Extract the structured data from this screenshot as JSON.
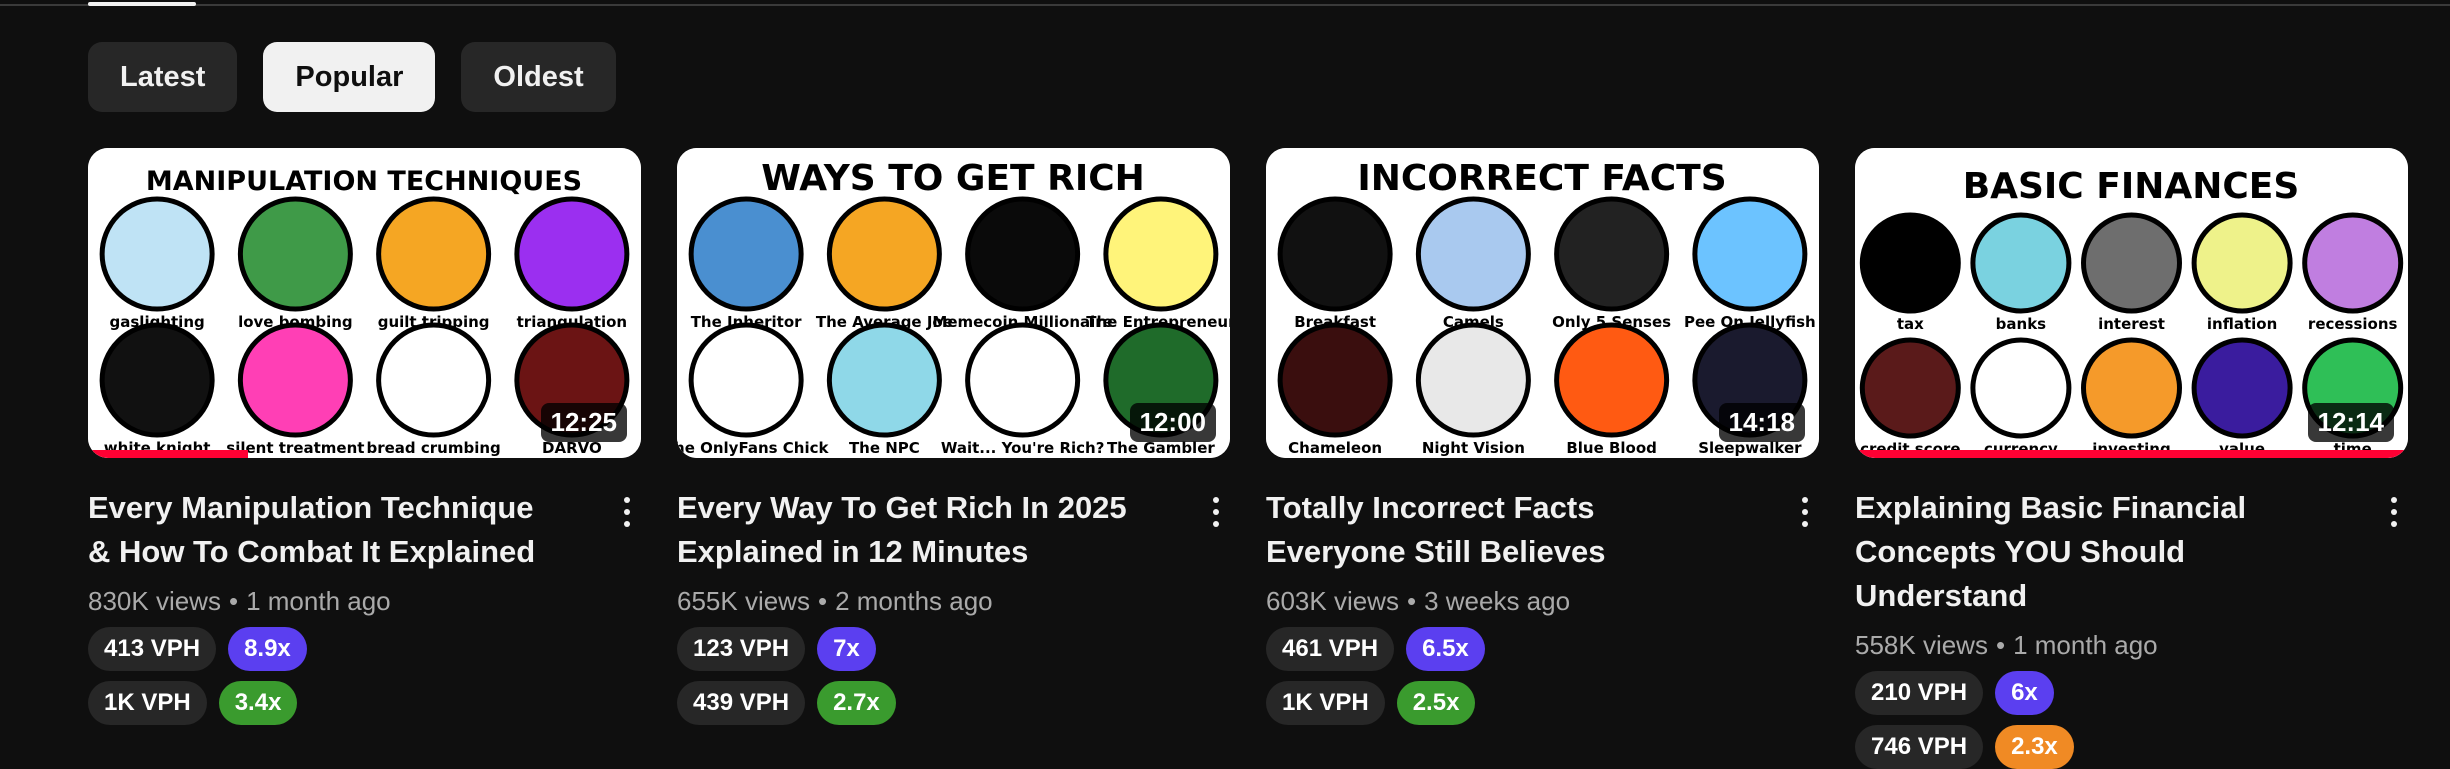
{
  "filters": [
    {
      "label": "Latest",
      "selected": false
    },
    {
      "label": "Popular",
      "selected": true
    },
    {
      "label": "Oldest",
      "selected": false
    }
  ],
  "colors": {
    "background": "#0f0f0f",
    "chip": "#272727",
    "chip_selected": "#f1f1f1",
    "progress": "#ff0033",
    "purple": "#5b3ff0",
    "green": "#3a9b2e",
    "orange": "#f08a24"
  },
  "videos": [
    {
      "thumb_title": "MANIPULATION TECHNIQUES",
      "thumb_labels": [
        "gaslighting",
        "love bombing",
        "guilt tripping",
        "triangulation",
        "white knight",
        "silent treatment",
        "bread crumbing",
        "DARVO"
      ],
      "duration": "12:25",
      "progress": 0.29,
      "title": "Every Manipulation Technique & How To Combat It Explained",
      "views": "830K views",
      "age": "1 month ago",
      "badges": [
        [
          {
            "text": "413 VPH",
            "color": "#272727"
          },
          {
            "text": "8.9x",
            "color": "#5b3ff0"
          }
        ],
        [
          {
            "text": "1K VPH",
            "color": "#272727"
          },
          {
            "text": "3.4x",
            "color": "#3a9b2e"
          }
        ]
      ]
    },
    {
      "thumb_title": "WAYS TO GET RICH",
      "thumb_labels": [
        "The Inheritor",
        "The Average Joe",
        "Memecoin Millionaire",
        "The Entrepreneur",
        "The OnlyFans Chick",
        "The NPC",
        "Wait... You're Rich?",
        "The Gambler"
      ],
      "duration": "12:00",
      "progress": 0,
      "title": "Every Way To Get Rich In 2025 Explained in 12 Minutes",
      "views": "655K views",
      "age": "2 months ago",
      "badges": [
        [
          {
            "text": "123 VPH",
            "color": "#272727"
          },
          {
            "text": "7x",
            "color": "#5b3ff0"
          }
        ],
        [
          {
            "text": "439 VPH",
            "color": "#272727"
          },
          {
            "text": "2.7x",
            "color": "#3a9b2e"
          }
        ]
      ]
    },
    {
      "thumb_title": "INCORRECT FACTS",
      "thumb_labels": [
        "Breakfast",
        "Camels",
        "Only 5 Senses",
        "Pee On Jellyfish",
        "Chameleon",
        "Night Vision",
        "Blue Blood",
        "Sleepwalker"
      ],
      "duration": "14:18",
      "progress": 0,
      "title": "Totally Incorrect Facts Everyone Still Believes",
      "views": "603K views",
      "age": "3 weeks ago",
      "badges": [
        [
          {
            "text": "461 VPH",
            "color": "#272727"
          },
          {
            "text": "6.5x",
            "color": "#5b3ff0"
          }
        ],
        [
          {
            "text": "1K VPH",
            "color": "#272727"
          },
          {
            "text": "2.5x",
            "color": "#3a9b2e"
          }
        ]
      ]
    },
    {
      "thumb_title": "BASIC FINANCES",
      "thumb_labels": [
        "tax",
        "banks",
        "interest",
        "inflation",
        "recessions",
        "credit score",
        "currency",
        "investing",
        "value",
        "time"
      ],
      "duration": "12:14",
      "progress": 1,
      "title": "Explaining Basic Financial Concepts YOU Should Understand",
      "views": "558K views",
      "age": "1 month ago",
      "badges": [
        [
          {
            "text": "210 VPH",
            "color": "#272727"
          },
          {
            "text": "6x",
            "color": "#5b3ff0"
          }
        ],
        [
          {
            "text": "746 VPH",
            "color": "#272727"
          },
          {
            "text": "2.3x",
            "color": "#f08a24"
          }
        ]
      ]
    }
  ]
}
